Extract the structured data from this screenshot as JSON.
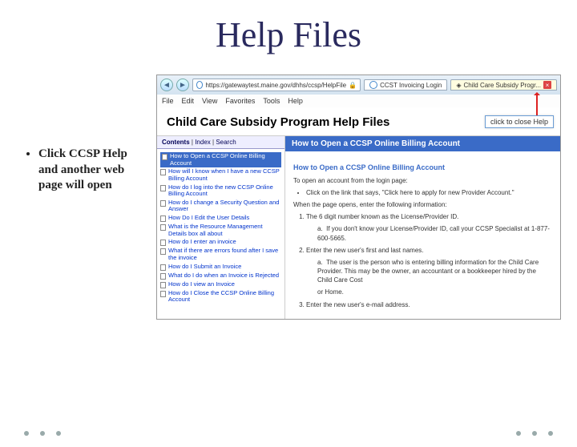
{
  "slide": {
    "title": "Help Files",
    "bullet": "Click CCSP Help and another web page will open"
  },
  "browser": {
    "url": "https://gatewaytest.maine.gov/dhhs/ccsp/HelpFile",
    "menus": [
      "File",
      "Edit",
      "View",
      "Favorites",
      "Tools",
      "Help"
    ],
    "tabs": [
      {
        "label": "CCST Invoicing Login",
        "active": false
      },
      {
        "label": "Child Care Subsidy Progr...",
        "active": true
      }
    ]
  },
  "callout": "click to close Help",
  "help": {
    "pageTitle": "Child Care Subsidy Program Help Files",
    "navTabs": [
      "Contents",
      "Index",
      "Search"
    ],
    "navItems": [
      "How to Open a CCSP Online Billing Account",
      "How will I know when I have a new CCSP Billing Account",
      "How do I log into the new CCSP Online Billing Account",
      "How do I change a Security Question and Answer",
      "How Do I Edit the User Details",
      "What is the Resource Management Details box all about",
      "How do I enter an invoice",
      "What if there are errors found after I save the invoice",
      "How do I Submit an Invoice",
      "What do I do when an Invoice is Rejected",
      "How do I view an Invoice",
      "How do I Close the CCSP Online Billing Account"
    ],
    "content": {
      "title": "How to Open a CCSP Online Billing Account",
      "subhead": "How to Open a CCSP Online Billing Account",
      "intro": "To open an account from the login page:",
      "step1": "Click on the link that says, \"Click here to apply for new Provider Account.\"",
      "afterOpen": "When the page opens, enter the following information:",
      "numbered": [
        "The 6 digit number known as the License/Provider ID.",
        "Enter the new user's first and last names.",
        "Enter the new user's e-mail address."
      ],
      "sub1": "If you don't know your License/Provider ID, call your CCSP Specialist at 1-877-600-5665.",
      "sub2": "The user is the person who is entering billing information for the Child Care Provider. This may be the owner, an accountant or a bookkeeper hired by the Child Care Cost",
      "orHome": "or Home."
    }
  }
}
